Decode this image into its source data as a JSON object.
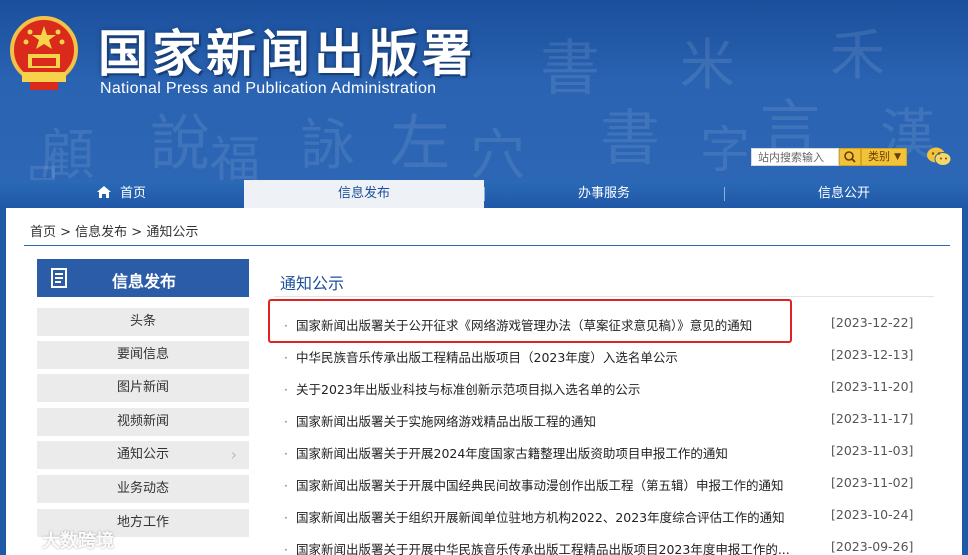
{
  "header": {
    "title": "国家新闻出版署",
    "subtitle": "National Press and Publication Administration",
    "search_placeholder": "站内搜索输入",
    "category_label": "类别"
  },
  "nav": {
    "items": [
      {
        "label": "首页"
      },
      {
        "label": "信息发布"
      },
      {
        "label": "办事服务"
      },
      {
        "label": "信息公开"
      }
    ]
  },
  "breadcrumb": "首页 > 信息发布 > 通知公示",
  "sidebar": {
    "title": "信息发布",
    "items": [
      {
        "label": "头条"
      },
      {
        "label": "要闻信息"
      },
      {
        "label": "图片新闻"
      },
      {
        "label": "视频新闻"
      },
      {
        "label": "通知公示"
      },
      {
        "label": "业务动态"
      },
      {
        "label": "地方工作"
      }
    ],
    "active_chevron": "›"
  },
  "main": {
    "section_title": "通知公示",
    "news": [
      {
        "title": "国家新闻出版署关于公开征求《网络游戏管理办法（草案征求意见稿）》意见的通知",
        "date": "[2023-12-22]"
      },
      {
        "title": "中华民族音乐传承出版工程精品出版项目（2023年度）入选名单公示",
        "date": "[2023-12-13]"
      },
      {
        "title": "关于2023年出版业科技与标准创新示范项目拟入选名单的公示",
        "date": "[2023-11-20]"
      },
      {
        "title": "国家新闻出版署关于实施网络游戏精品出版工程的通知",
        "date": "[2023-11-17]"
      },
      {
        "title": "国家新闻出版署关于开展2024年度国家古籍整理出版资助项目申报工作的通知",
        "date": "[2023-11-03]"
      },
      {
        "title": "国家新闻出版署关于开展中国经典民间故事动漫创作出版工程（第五辑）申报工作的通知",
        "date": "[2023-11-02]"
      },
      {
        "title": "国家新闻出版署关于组织开展新闻单位驻地方机构2022、2023年度综合评估工作的通知",
        "date": "[2023-10-24]"
      },
      {
        "title": "国家新闻出版署关于开展中华民族音乐传承出版工程精品出版项目2023年度申报工作的...",
        "date": "[2023-09-26]"
      }
    ]
  },
  "watermark": "大数跨境",
  "colors": {
    "banner_blue": "#2a63b2",
    "nav_active_bg": "#eef2f7",
    "sidebar_head": "#2b5ca8",
    "highlight_red": "#e02222",
    "search_yellow": "#f1c33a"
  }
}
